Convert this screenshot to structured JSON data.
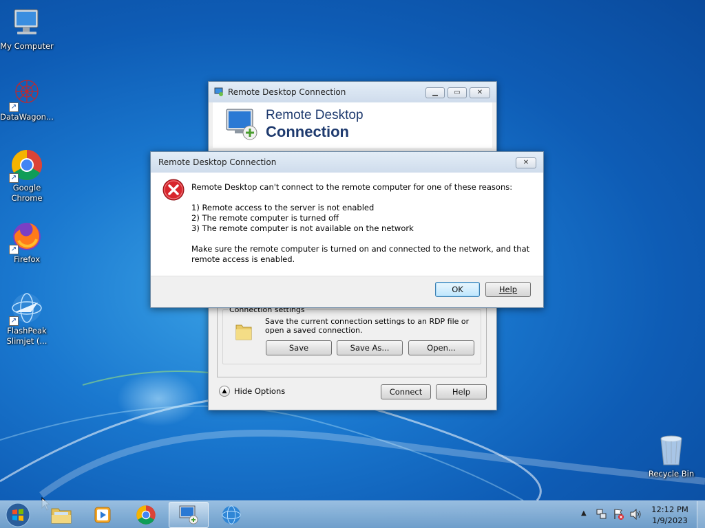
{
  "desktop": {
    "icons": [
      {
        "label": "My Computer"
      },
      {
        "label": "DataWagon..."
      },
      {
        "label": "Google Chrome"
      },
      {
        "label": "Firefox"
      },
      {
        "label": "FlashPeak Slimjet (..."
      },
      {
        "label": "Recycle Bin"
      }
    ]
  },
  "rdc_window": {
    "title": "Remote Desktop Connection",
    "banner_line1": "Remote Desktop",
    "banner_line2": "Connection",
    "connection_settings_label": "Connection settings",
    "connection_settings_text": "Save the current connection settings to an RDP file or open a saved connection.",
    "save_label": "Save",
    "save_as_label": "Save As...",
    "open_label": "Open...",
    "hide_options_label": "Hide Options",
    "connect_label": "Connect",
    "help_label": "Help"
  },
  "error_dialog": {
    "title": "Remote Desktop Connection",
    "message": "Remote Desktop can't connect to the remote computer for one of these reasons:",
    "reasons": [
      "1) Remote access to the server is not enabled",
      "2) The remote computer is turned off",
      "3) The remote computer is not available on the network"
    ],
    "footer": "Make sure the remote computer is turned on and connected to the network, and that remote access is enabled.",
    "ok_label": "OK",
    "help_label": "Help"
  },
  "taskbar": {
    "time": "12:12 PM",
    "date": "1/9/2023"
  }
}
